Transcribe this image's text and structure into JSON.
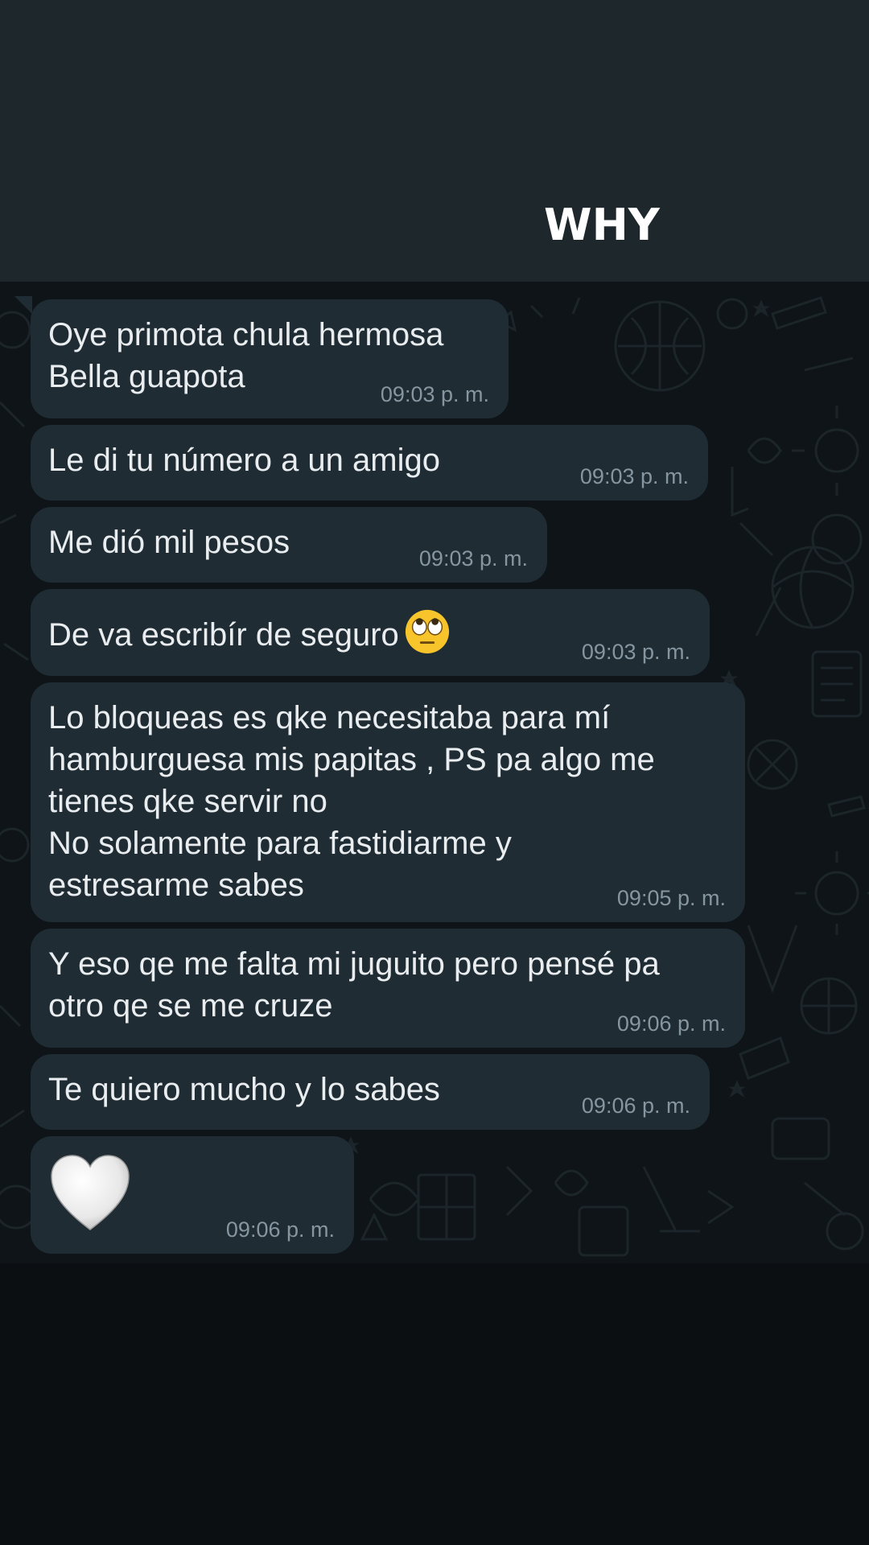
{
  "header": {
    "title": "WHY"
  },
  "messages": [
    {
      "text": "Oye primota chula hermosa\nBella guapota",
      "time": "09:03 p. m."
    },
    {
      "text": "Le di tu número a un amigo",
      "time": "09:03 p. m."
    },
    {
      "text": "Me dió mil pesos",
      "time": "09:03 p. m."
    },
    {
      "text": "De va escribír de seguro",
      "emoji": "face-with-rolling-eyes",
      "time": "09:03 p. m."
    },
    {
      "text": "Lo bloqueas es qke necesitaba para mí\nhamburguesa mis papitas , PS pa algo me\ntienes qke servir no\nNo solamente para fastidiarme y\nestresarme sabes",
      "time": "09:05 p. m."
    },
    {
      "text": "Y eso qe me falta mi juguito pero pensé pa\notro qe se me cruze",
      "time": "09:06 p. m."
    },
    {
      "text": "Te quiero mucho y lo sabes",
      "time": "09:06 p. m."
    },
    {
      "emoji": "white-heart",
      "time": "09:06 p. m."
    }
  ],
  "colors": {
    "header_bg": "#1e272c",
    "bubble_bg": "#1f2c34",
    "text": "#e9edef",
    "timestamp": "#8696a0",
    "wallpaper_bg": "#0e1418"
  }
}
